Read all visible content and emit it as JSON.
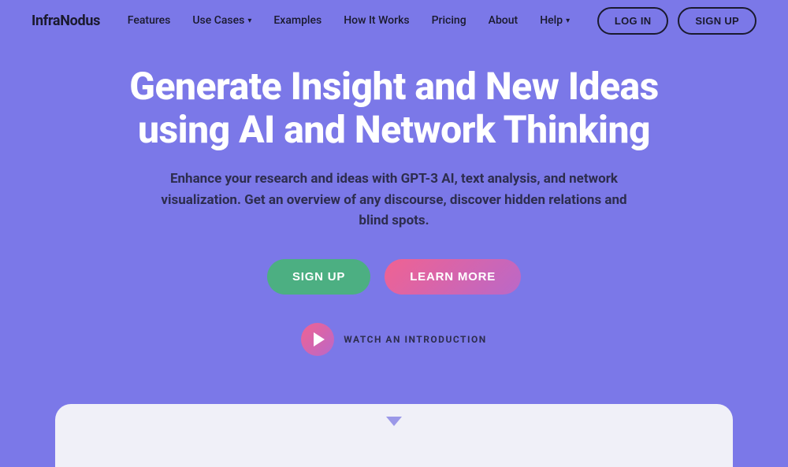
{
  "brand": {
    "name": "InfraNodus"
  },
  "navbar": {
    "links": [
      {
        "label": "Features",
        "hasDropdown": false
      },
      {
        "label": "Use Cases",
        "hasDropdown": true
      },
      {
        "label": "Examples",
        "hasDropdown": false
      },
      {
        "label": "How It Works",
        "hasDropdown": false
      },
      {
        "label": "Pricing",
        "hasDropdown": false
      },
      {
        "label": "About",
        "hasDropdown": false
      },
      {
        "label": "Help",
        "hasDropdown": true
      }
    ],
    "login_label": "LOG IN",
    "signup_label": "SIGN UP"
  },
  "hero": {
    "title": "Generate Insight and New Ideas using AI and Network Thinking",
    "subtitle": "Enhance your research and ideas with GPT-3 AI, text analysis, and network visualization. Get an overview of any discourse, discover hidden relations and blind spots.",
    "cta_signup": "SIGN UP",
    "cta_learn": "LEARN MORE",
    "watch_label": "WATCH AN INTRODUCTION"
  },
  "colors": {
    "bg": "#7b78e8",
    "title_color": "#ffffff",
    "subtitle_color": "#2d2d4e",
    "signup_btn": "#4caf82",
    "learn_btn_gradient_start": "#f06292",
    "learn_btn_gradient_end": "#ba68c8",
    "play_btn_gradient_start": "#f06292",
    "play_btn_gradient_end": "#ba68c8"
  }
}
